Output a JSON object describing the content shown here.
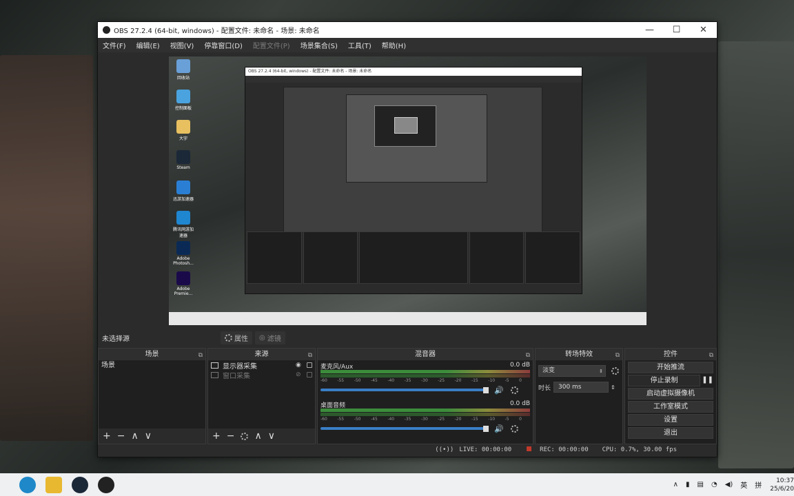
{
  "window": {
    "title": "OBS 27.2.4 (64-bit, windows) - 配置文件: 未命名 - 场景: 未命名",
    "minimize": "—",
    "maximize": "☐",
    "close": "✕"
  },
  "menu": [
    "文件(F)",
    "编辑(E)",
    "视图(V)",
    "停靠窗口(D)",
    "配置文件(P)",
    "场景集合(S)",
    "工具(T)",
    "帮助(H)"
  ],
  "desktop_icons": [
    {
      "label": "回收站",
      "color": "#6aa0d8"
    },
    {
      "label": "控制面板",
      "color": "#4aa3df"
    },
    {
      "label": "大宇",
      "color": "#e8c060"
    },
    {
      "label": "Steam",
      "color": "#1b2838"
    },
    {
      "label": "迅游加速器",
      "color": "#2a7fd4"
    },
    {
      "label": "腾讯网游加速器",
      "color": "#1f86d0"
    },
    {
      "label": "Adobe Photosh...",
      "color": "#0a2a55"
    },
    {
      "label": "Adobe Premie...",
      "color": "#1a0a4a"
    }
  ],
  "scene_bar": {
    "no_selection": "未选择源",
    "properties": "属性",
    "filters": "滤镜"
  },
  "scenes": {
    "header": "场景",
    "items": [
      "场景"
    ]
  },
  "sources": {
    "header": "来源",
    "items": [
      {
        "label": "显示器采集",
        "visible": true
      },
      {
        "label": "窗口采集",
        "visible": false
      }
    ]
  },
  "mixer": {
    "header": "混音器",
    "channels": [
      {
        "name": "麦克风/Aux",
        "db": "0.0 dB"
      },
      {
        "name": "桌面音频",
        "db": "0.0 dB"
      }
    ],
    "ticks": [
      "-60",
      "-55",
      "-50",
      "-45",
      "-40",
      "-35",
      "-30",
      "-25",
      "-20",
      "-15",
      "-10",
      "-5",
      "0"
    ]
  },
  "transitions": {
    "header": "转场特效",
    "selected": "淡变",
    "duration_label": "时长",
    "duration": "300 ms"
  },
  "controls": {
    "header": "控件",
    "buttons": [
      "开始推流",
      "停止录制",
      "启动虚拟摄像机",
      "工作室模式",
      "设置",
      "退出"
    ]
  },
  "status": {
    "live": "LIVE: 00:00:00",
    "rec": "REC: 00:00:00",
    "cpu": "CPU: 0.7%, 30.00 fps"
  },
  "taskbar": {
    "apps": [
      {
        "name": "edge",
        "color": "#1e88c8"
      },
      {
        "name": "file-explorer",
        "color": "#e8b830"
      },
      {
        "name": "steam",
        "color": "#1b2838"
      },
      {
        "name": "obs",
        "color": "#222"
      }
    ],
    "tray": {
      "ime": "英",
      "ime2": "拼",
      "time": "10:37",
      "date": "25/6/20"
    }
  }
}
